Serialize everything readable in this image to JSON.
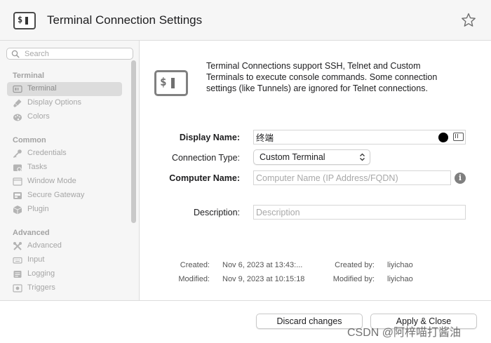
{
  "header": {
    "title": "Terminal Connection Settings",
    "icon_glyph": "$",
    "icon": "terminal-icon",
    "favorite_icon": "star-icon"
  },
  "sidebar": {
    "search": {
      "placeholder": "Search",
      "value": ""
    },
    "sections": [
      {
        "title": "Terminal",
        "items": [
          {
            "label": "Terminal",
            "icon": "terminal-icon",
            "selected": true
          },
          {
            "label": "Display Options",
            "icon": "brush-icon"
          },
          {
            "label": "Colors",
            "icon": "palette-icon"
          }
        ]
      },
      {
        "title": "Common",
        "items": [
          {
            "label": "Credentials",
            "icon": "key-icon"
          },
          {
            "label": "Tasks",
            "icon": "tasks-icon"
          },
          {
            "label": "Window Mode",
            "icon": "window-icon"
          },
          {
            "label": "Secure Gateway",
            "icon": "gateway-icon"
          },
          {
            "label": "Plugin",
            "icon": "plugin-icon"
          }
        ]
      },
      {
        "title": "Advanced",
        "items": [
          {
            "label": "Advanced",
            "icon": "tools-icon"
          },
          {
            "label": "Input",
            "icon": "keyboard-icon"
          },
          {
            "label": "Logging",
            "icon": "log-icon"
          },
          {
            "label": "Triggers",
            "icon": "trigger-icon"
          }
        ]
      }
    ]
  },
  "main": {
    "description_lines": [
      "Terminal Connections support SSH, Telnet and Custom",
      "Terminals to execute console commands. Some connection",
      "settings (like Tunnels) are ignored for Telnet connections."
    ],
    "form": {
      "display_name_label": "Display Name:",
      "display_name_value": "终端",
      "display_color": "#000000",
      "connection_type_label": "Connection Type:",
      "connection_type_value": "Custom Terminal",
      "computer_name_label": "Computer Name:",
      "computer_name_placeholder": "Computer Name (IP Address/FQDN)",
      "computer_name_value": "",
      "description_label": "Description:",
      "description_placeholder": "Description",
      "description_value": ""
    },
    "meta": {
      "created_label": "Created:",
      "created_value": "Nov 6, 2023 at 13:43:...",
      "created_by_label": "Created by:",
      "created_by_value": "liyichao",
      "modified_label": "Modified:",
      "modified_value": "Nov 9, 2023 at 10:15:18",
      "modified_by_label": "Modified by:",
      "modified_by_value": "liyichao"
    }
  },
  "footer": {
    "discard_label": "Discard changes",
    "apply_label": "Apply & Close"
  },
  "watermark": "CSDN @阿梓喵打酱油"
}
